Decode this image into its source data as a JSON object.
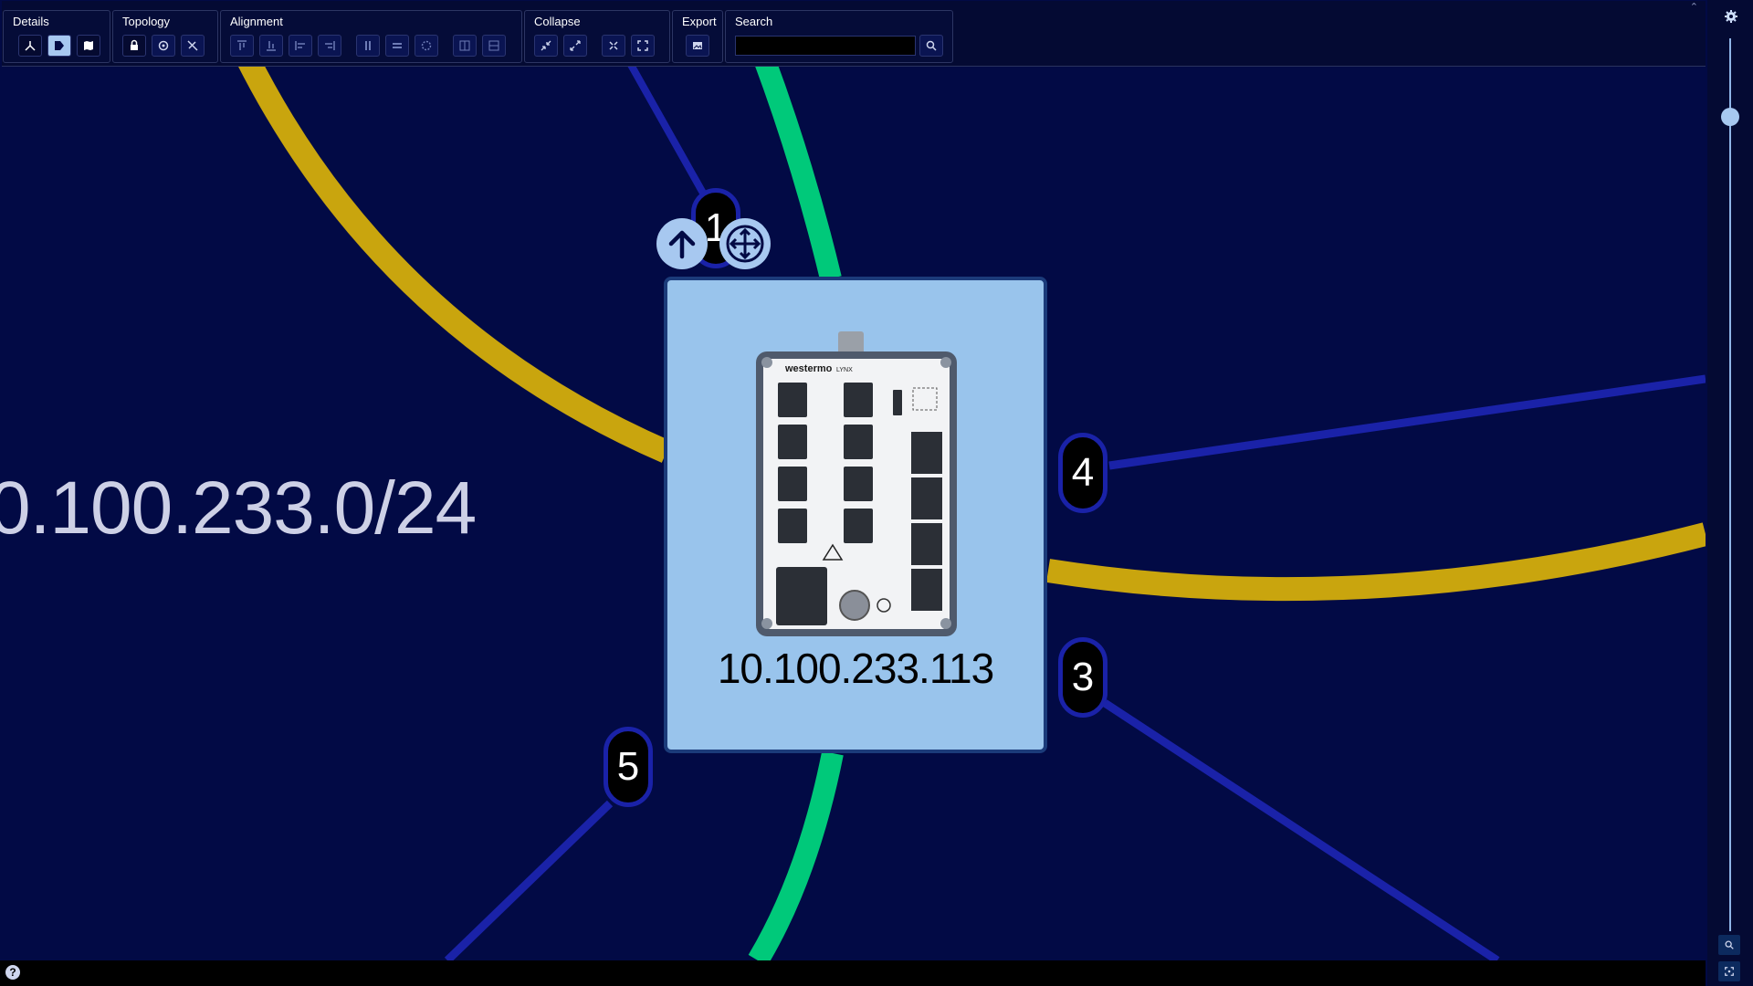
{
  "toolbar": {
    "groups": {
      "details": "Details",
      "topology": "Topology",
      "alignment": "Alignment",
      "collapse": "Collapse",
      "export": "Export",
      "search": "Search"
    },
    "search_value": "",
    "collapse_toggle_icon": "chevron-up-icon"
  },
  "canvas": {
    "subnet_label": "0.100.233.0/24",
    "node": {
      "ip": "10.100.233.113",
      "device_brand": "westermo",
      "device_model": "LYNX",
      "role_icon": "arrow-up-icon",
      "type_icon": "router-icon"
    },
    "ports": {
      "p1": "1",
      "p3": "3",
      "p4": "4",
      "p5": "5"
    },
    "colors": {
      "background": "#020a45",
      "gold_link": "#c9a50e",
      "green_link": "#00c97a",
      "blue_link": "#1a22a8",
      "node_fill": "#99c4ec"
    }
  },
  "sidebar": {
    "settings_icon": "gear-icon",
    "zoom_icon": "zoom-icon",
    "fit_icon": "fit-screen-icon"
  },
  "footer": {
    "help_label": "?"
  }
}
